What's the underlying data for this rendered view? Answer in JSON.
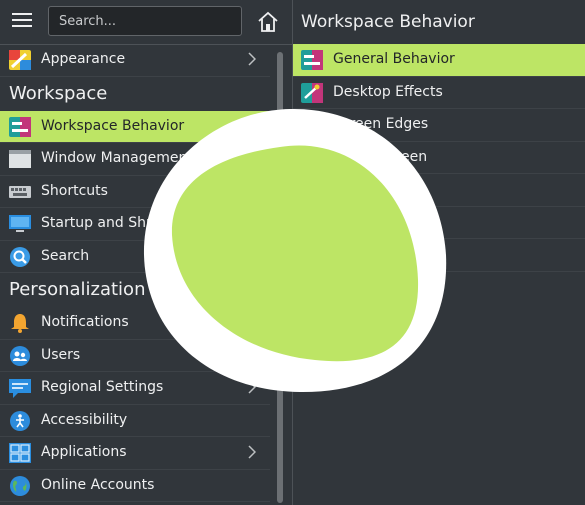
{
  "search": {
    "placeholder": "Search..."
  },
  "colors": {
    "accent": "#bde565",
    "background": "#31363b"
  },
  "sidebar": {
    "top_item": {
      "label": "Appearance",
      "icon": "appearance-icon"
    },
    "sections": [
      {
        "title": "Workspace",
        "items": [
          {
            "label": "Workspace Behavior",
            "icon": "workspace-behavior-icon",
            "selected": true
          },
          {
            "label": "Window Management",
            "icon": "window-management-icon"
          },
          {
            "label": "Shortcuts",
            "icon": "keyboard-icon"
          },
          {
            "label": "Startup and Shutdown",
            "icon": "monitor-icon"
          },
          {
            "label": "Search",
            "icon": "search-icon"
          }
        ]
      },
      {
        "title": "Personalization",
        "items": [
          {
            "label": "Notifications",
            "icon": "bell-icon"
          },
          {
            "label": "Users",
            "icon": "users-icon"
          },
          {
            "label": "Regional Settings",
            "icon": "chat-icon",
            "has_submenu": true
          },
          {
            "label": "Accessibility",
            "icon": "accessibility-icon"
          },
          {
            "label": "Applications",
            "icon": "applications-icon",
            "has_submenu": true
          },
          {
            "label": "Online Accounts",
            "icon": "globe-icon"
          }
        ]
      }
    ]
  },
  "right": {
    "title": "Workspace Behavior",
    "items": [
      {
        "label": "General Behavior",
        "selected": true
      },
      {
        "label": "Desktop Effects"
      },
      {
        "label": "Screen Edges"
      },
      {
        "label": "Screen"
      },
      {
        "label": "ing"
      },
      {
        "label": "ns"
      }
    ]
  }
}
